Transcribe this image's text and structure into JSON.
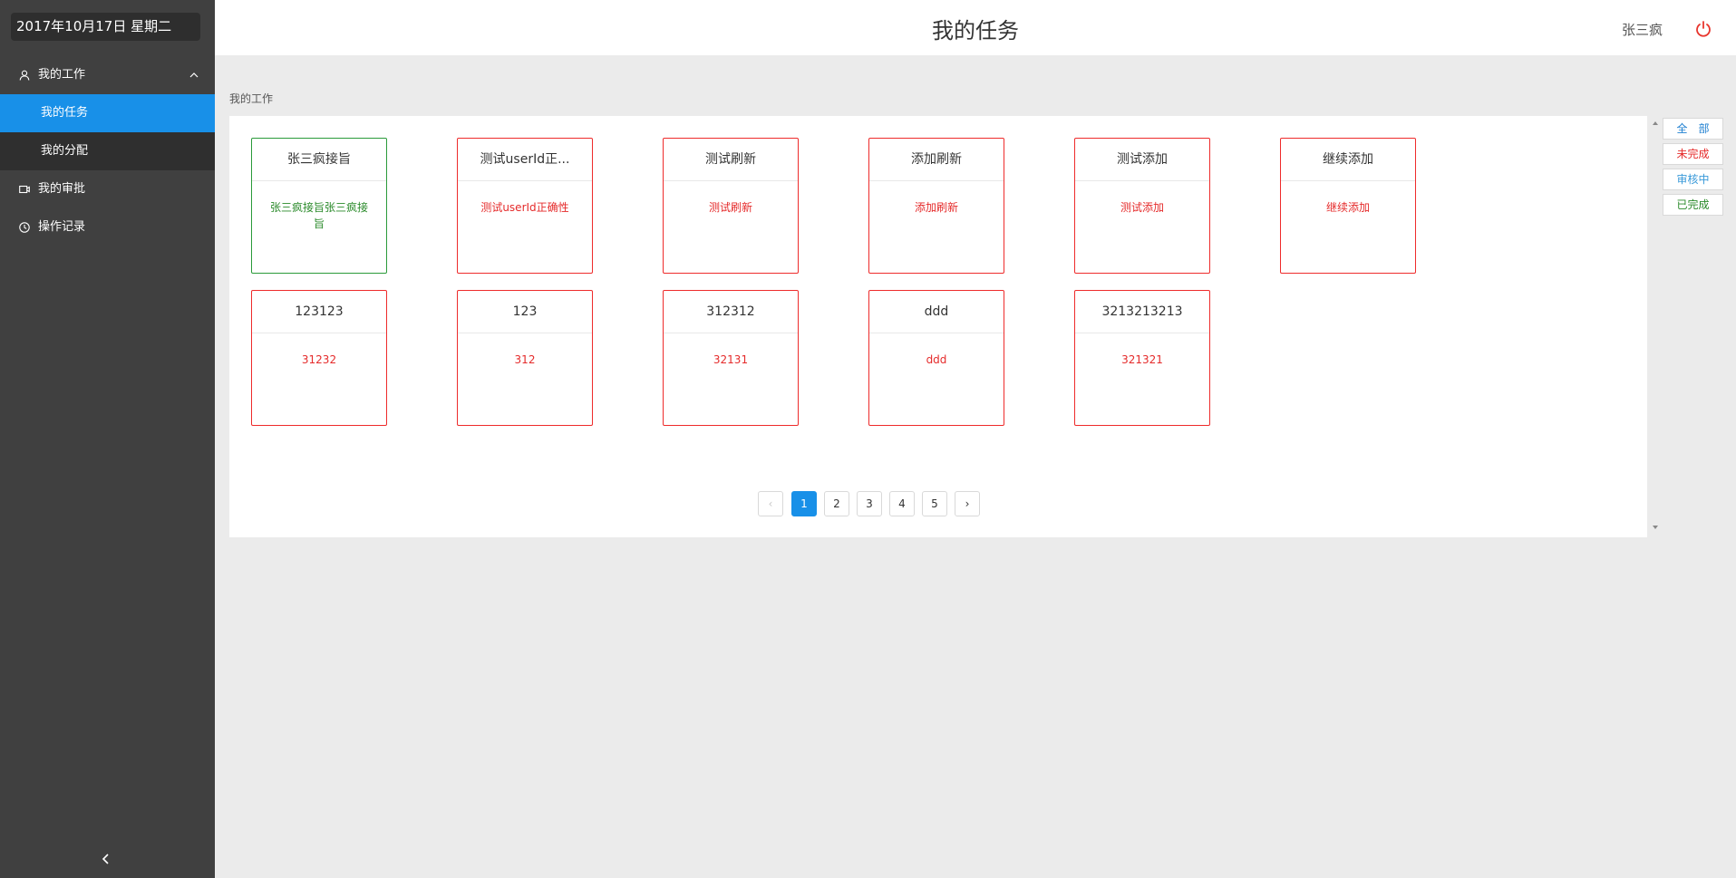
{
  "sidebar": {
    "date": "2017年10月17日 星期二",
    "menu": [
      {
        "label": "我的工作",
        "icon": "user-icon"
      },
      {
        "label": "我的审批",
        "icon": "video-icon"
      },
      {
        "label": "操作记录",
        "icon": "clock-icon"
      }
    ],
    "submenu": [
      {
        "label": "我的任务",
        "active": true
      },
      {
        "label": "我的分配",
        "active": false
      }
    ]
  },
  "header": {
    "title": "我的任务",
    "user": "张三疯"
  },
  "breadcrumb": "我的工作",
  "cards": [
    {
      "title": "张三疯接旨",
      "body": "张三疯接旨张三疯接旨",
      "status": "done"
    },
    {
      "title": "测试userId正...",
      "body": "测试userId正确性",
      "status": "pending"
    },
    {
      "title": "测试刷新",
      "body": "测试刷新",
      "status": "pending"
    },
    {
      "title": "添加刷新",
      "body": "添加刷新",
      "status": "pending"
    },
    {
      "title": "测试添加",
      "body": "测试添加",
      "status": "pending"
    },
    {
      "title": "继续添加",
      "body": "继续添加",
      "status": "pending"
    },
    {
      "title": "123123",
      "body": "31232",
      "status": "pending"
    },
    {
      "title": "123",
      "body": "312",
      "status": "pending"
    },
    {
      "title": "312312",
      "body": "32131",
      "status": "pending"
    },
    {
      "title": "ddd",
      "body": "ddd",
      "status": "pending"
    },
    {
      "title": "3213213213",
      "body": "321321",
      "status": "pending"
    }
  ],
  "pagination": {
    "pages": [
      "1",
      "2",
      "3",
      "4",
      "5"
    ],
    "current": "1",
    "prev": "‹",
    "next": "›"
  },
  "filters": [
    {
      "label": "全　部",
      "color": "#1e7fd0"
    },
    {
      "label": "未完成",
      "color": "#e52b2b"
    },
    {
      "label": "审核中",
      "color": "#3a9ad9"
    },
    {
      "label": "已完成",
      "color": "#2a8a2a"
    }
  ],
  "colors": {
    "accent": "#1890e8",
    "pending_border": "#ee2b2b",
    "done_border": "#2a9a3a",
    "sidebar_bg": "#404040"
  }
}
